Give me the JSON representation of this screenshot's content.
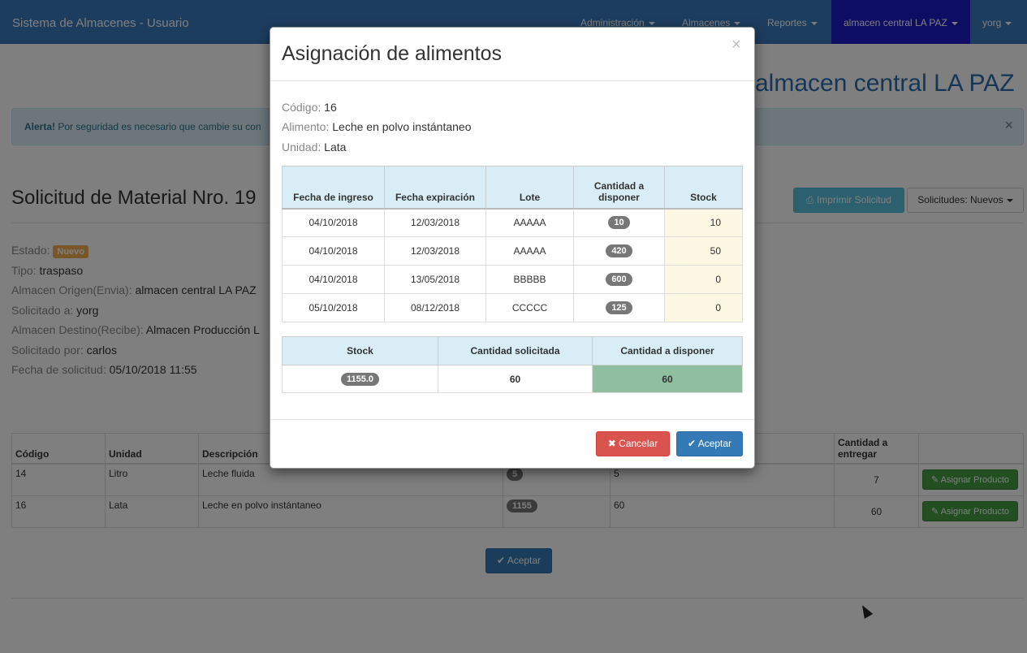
{
  "navbar": {
    "brand": "Sistema de Almacenes - Usuario",
    "menus": [
      "Administración",
      "Almacenes",
      "Reportes"
    ],
    "active": "almacen central LA PAZ",
    "user": "yorg"
  },
  "page": {
    "heading": "almacen central LA PAZ",
    "alert_strong": "Alerta!",
    "alert_text": "Por seguridad es necesario que cambie su con",
    "alert_close": "×",
    "title": "Solicitud de Material Nro. 19",
    "print_label": "Imprimir Solicitud",
    "filter_label": "Solicitudes: Nuevos",
    "estado_label": "Estado:",
    "estado_value": "Nuevo",
    "tipo_label": "Tipo:",
    "tipo_value": "traspaso",
    "origen_label": "Almacen Origen(Envia):",
    "origen_value": "almacen central LA PAZ",
    "solicitado_a_label": "Solicitado a:",
    "solicitado_a_value": "yorg",
    "destino_label": "Almacen Destino(Recibe):",
    "destino_value": "Almacen Producción L",
    "solicitado_por_label": "Solicitado por:",
    "solicitado_por_value": "carlos",
    "fecha_label": "Fecha de solicitud:",
    "fecha_value": "05/10/2018 11:55",
    "accept_label": "Aceptar"
  },
  "main_table": {
    "headers": [
      "Código",
      "Unidad",
      "Descripción",
      "",
      "",
      "Cantidad a entregar",
      ""
    ],
    "rows": [
      {
        "codigo": "14",
        "unidad": "Litro",
        "descripcion": "Leche fluida",
        "stock": "5",
        "solicitada": "5",
        "entregar": "7",
        "action": "Asignar Producto"
      },
      {
        "codigo": "16",
        "unidad": "Lata",
        "descripcion": "Leche en polvo instántaneo",
        "stock": "1155",
        "solicitada": "60",
        "entregar": "60",
        "action": "Asignar Producto"
      }
    ]
  },
  "modal": {
    "title": "Asignación de alimentos",
    "close": "×",
    "codigo_label": "Código:",
    "codigo_value": "16",
    "alimento_label": "Alimento:",
    "alimento_value": "Leche en polvo instántaneo",
    "unidad_label": "Unidad:",
    "unidad_value": "Lata",
    "lot_headers": [
      "Fecha de ingreso",
      "Fecha expiración",
      "Lote",
      "Cantidad a disponer",
      "Stock"
    ],
    "lots": [
      {
        "ingreso": "04/10/2018",
        "expiracion": "12/03/2018",
        "lote": "AAAAA",
        "cantidad": "10",
        "stock": "10"
      },
      {
        "ingreso": "04/10/2018",
        "expiracion": "12/03/2018",
        "lote": "AAAAA",
        "cantidad": "420",
        "stock": "50"
      },
      {
        "ingreso": "04/10/2018",
        "expiracion": "13/05/2018",
        "lote": "BBBBB",
        "cantidad": "600",
        "stock": "0"
      },
      {
        "ingreso": "05/10/2018",
        "expiracion": "08/12/2018",
        "lote": "CCCCC",
        "cantidad": "125",
        "stock": "0"
      }
    ],
    "summary_headers": [
      "Stock",
      "Cantidad solicitada",
      "Cantidad a disponer"
    ],
    "summary": {
      "stock": "1155.0",
      "solicitada": "60",
      "disponer": "60"
    },
    "cancel_label": "Cancelar",
    "accept_label": "Aceptar"
  }
}
